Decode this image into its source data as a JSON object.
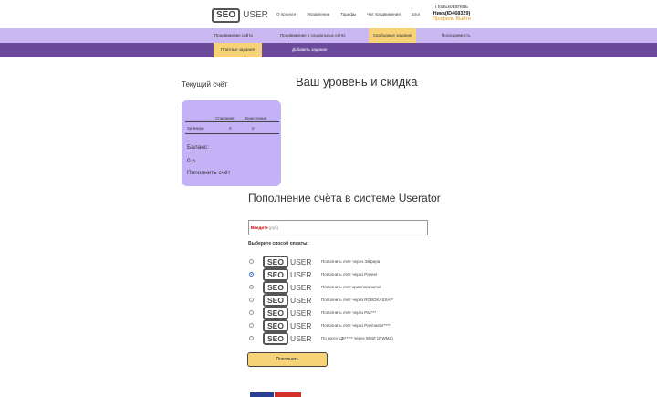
{
  "header": {
    "logo_box": "SEO",
    "logo_text": "USER",
    "nav": [
      "О проекте",
      "Управление",
      "Тарифы",
      "Чат продвижения",
      "Блог"
    ],
    "user_role": "Пользователь",
    "user_name": "Ника(ID468329)",
    "user_link": "Профиль Выйти"
  },
  "nav_primary": {
    "items": [
      "Продвижение сайта",
      "Продвижение в социальных сетях",
      "Свободные задания",
      "Посещаемость"
    ],
    "active_index": 2
  },
  "nav_secondary": {
    "items": [
      "Платные задания",
      "Добавить задание"
    ],
    "active_index": 0
  },
  "sidebar": {
    "title": "Текущий счёт",
    "table": {
      "headers": [
        "Списание",
        "Зачисление"
      ],
      "row": {
        "label": "За вчера",
        "debit": "0",
        "credit": "0"
      }
    },
    "balance_label": "Баланс:",
    "balance_value": "0 р.",
    "topup_link": "Пополнить счёт"
  },
  "main": {
    "level_title": "Ваш уровень и скидка",
    "topup_title": "Пополнение счёта в системе Userator",
    "amount": {
      "required_label": "Введите",
      "unit": "(руб)"
    },
    "choose_label": "Выберите способ оплаты:",
    "methods": [
      {
        "logo_box": "SEO",
        "logo_text": "USER",
        "label": "Пополнить счёт через Эйфера",
        "checked": false
      },
      {
        "logo_box": "SEO",
        "logo_text": "USER",
        "label": "Пополнить счёт через Payeer",
        "checked": true
      },
      {
        "logo_box": "SEO",
        "logo_text": "USER",
        "label": "Пополнить счёт криптовалютой",
        "checked": false
      },
      {
        "logo_box": "SEO",
        "logo_text": "USER",
        "label": "Пополнить счёт через ROBOKASSA**",
        "checked": false
      },
      {
        "logo_box": "SEO",
        "logo_text": "USER",
        "label": "Пополнить счёт через Рас***",
        "checked": false
      },
      {
        "logo_box": "SEO",
        "logo_text": "USER",
        "label": "Пополнить счёт через Paymaster****",
        "checked": false
      },
      {
        "logo_box": "SEO",
        "logo_text": "USER",
        "label": "По курсу ЦБ***** через WMZ (Z-WMZ)",
        "checked": false
      }
    ],
    "pay_button": "Пополнить"
  },
  "colors": {
    "nav_primary_bg": "#c9b8f2",
    "nav_secondary_bg": "#6b4a9c",
    "accent_yellow": "#f6d377",
    "card_bg": "#c4b2f7",
    "radio_checked": "#3a7bd5"
  }
}
